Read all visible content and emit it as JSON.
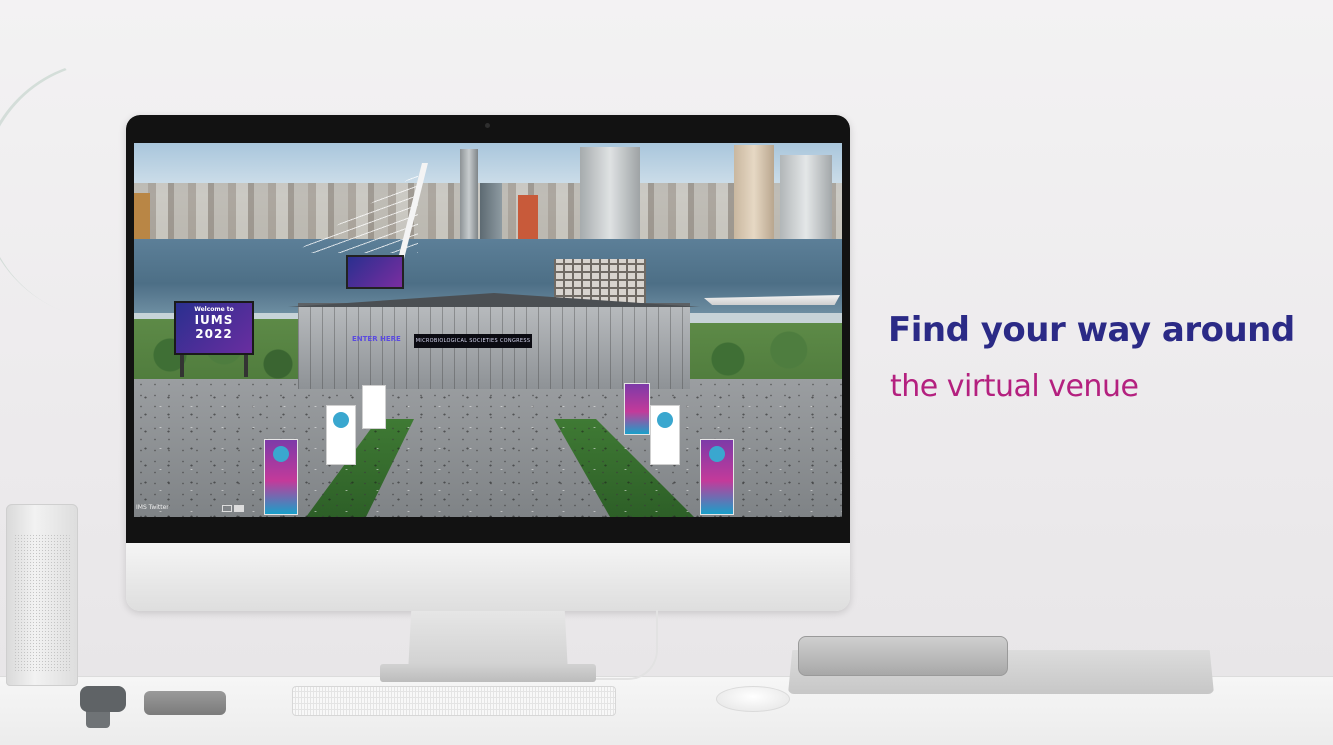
{
  "headline": {
    "title": "Find your way around",
    "subtitle": "the virtual venue"
  },
  "screen": {
    "hall_sign": "MICROBIOLOGICAL SOCIETIES CONGRESS",
    "enter_sign": "ENTER HERE",
    "billboard": {
      "line1": "Welcome to",
      "line2": "IUMS 2022"
    },
    "bottom_label": "IMS Twitter"
  },
  "colors": {
    "headline": "#2b2a86",
    "subtitle": "#b4207f"
  },
  "icons": {
    "speaker": "speaker-icon",
    "keyboard": "keyboard-icon",
    "mouse": "mouse-icon"
  }
}
